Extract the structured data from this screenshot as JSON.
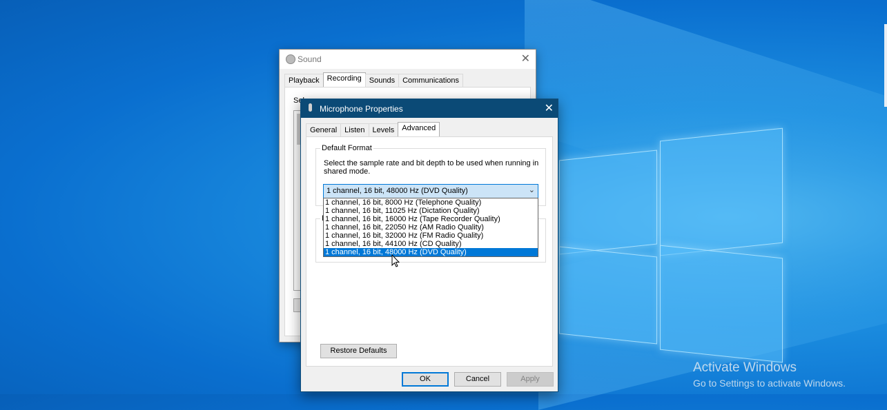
{
  "desktop": {
    "watermark": {
      "line1": "Activate Windows",
      "line2": "Go to Settings to activate Windows."
    },
    "accent": "#0a6fcf"
  },
  "sound_dialog": {
    "title": "Sound",
    "close_glyph": "✕",
    "tabs": [
      "Playback",
      "Recording",
      "Sounds",
      "Communications"
    ],
    "active_tab": "Recording",
    "partial_text": "Sel"
  },
  "mic_dialog": {
    "title": "Microphone Properties",
    "close_glyph": "✕",
    "tabs": [
      "General",
      "Listen",
      "Levels",
      "Advanced"
    ],
    "active_tab": "Advanced",
    "default_format": {
      "group_title": "Default Format",
      "description": "Select the sample rate and bit depth to be used when running in shared mode.",
      "selected_value": "1 channel, 16 bit, 48000 Hz (DVD Quality)",
      "options": [
        "1 channel, 16 bit, 8000 Hz (Telephone Quality)",
        "1 channel, 16 bit, 11025 Hz (Dictation Quality)",
        "1 channel, 16 bit, 16000 Hz (Tape Recorder Quality)",
        "1 channel, 16 bit, 22050 Hz (AM Radio Quality)",
        "1 channel, 16 bit, 32000 Hz (FM Radio Quality)",
        "1 channel, 16 bit, 44100 Hz (CD Quality)",
        "1 channel, 16 bit, 48000 Hz (DVD Quality)"
      ],
      "highlighted_index": 6
    },
    "exclusive_group_letter": "E",
    "buttons": {
      "restore": "Restore Defaults",
      "ok": "OK",
      "cancel": "Cancel",
      "apply": "Apply"
    }
  }
}
